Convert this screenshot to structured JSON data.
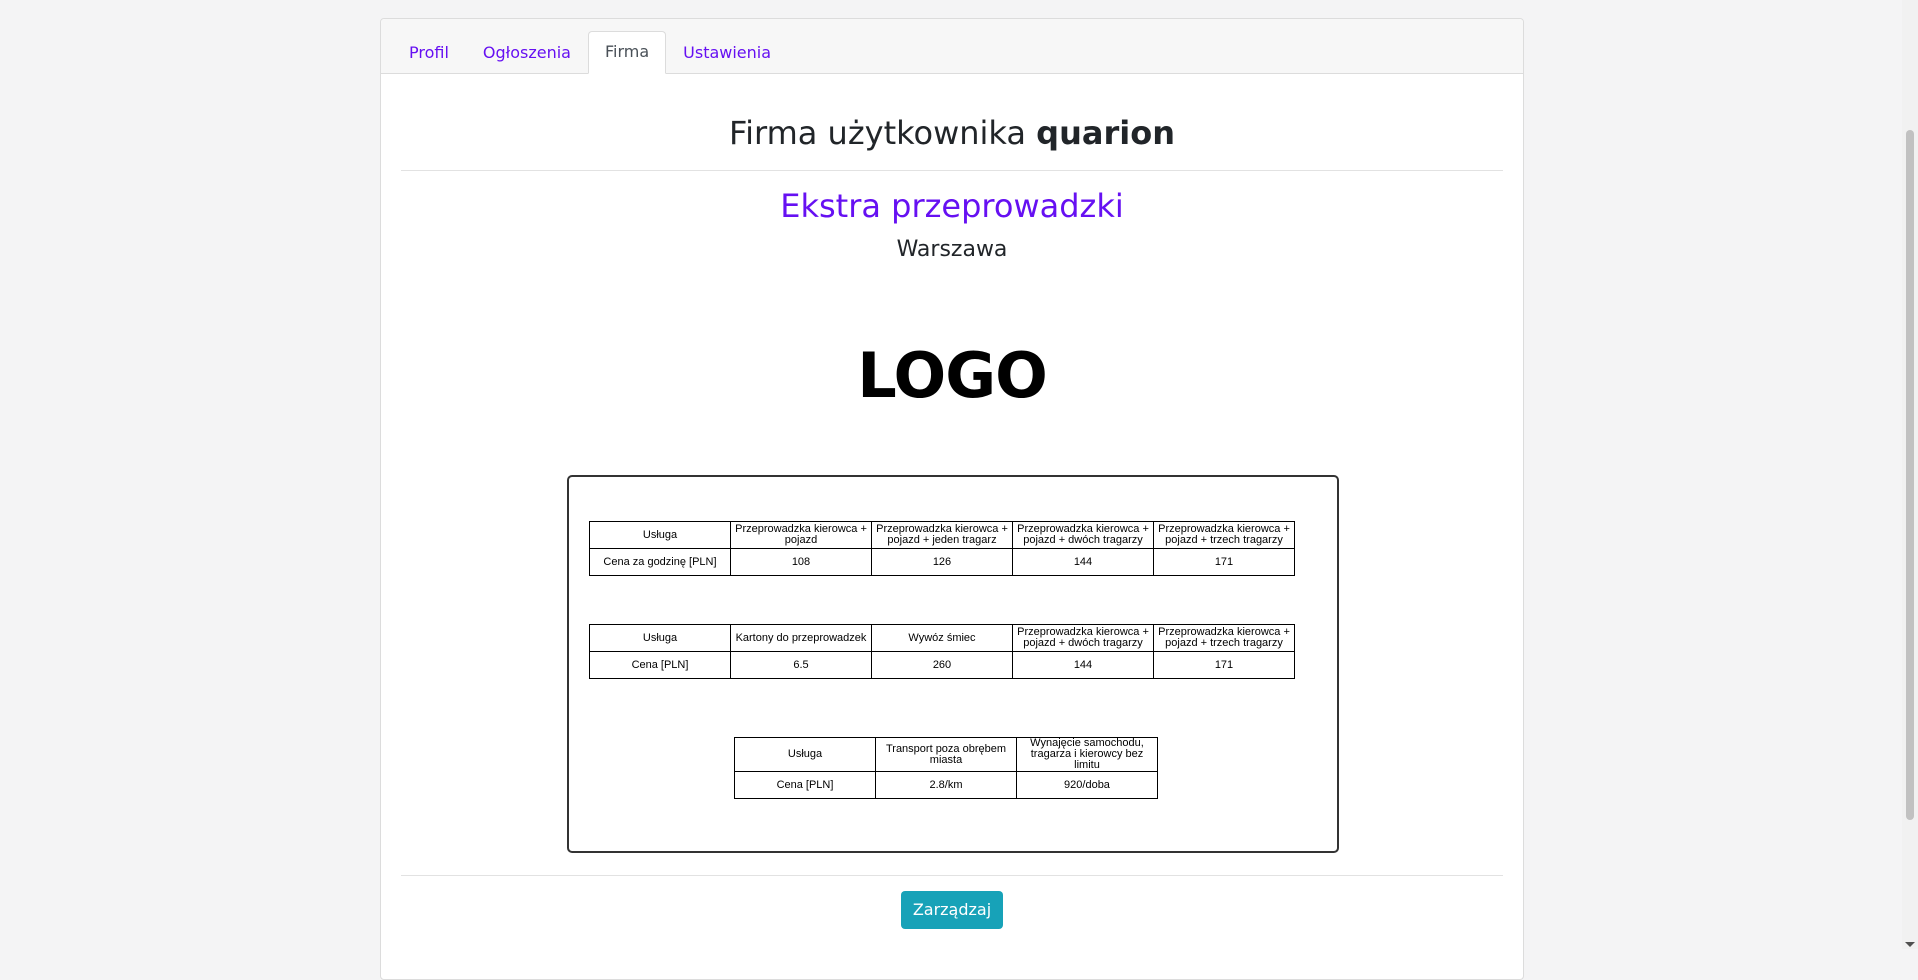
{
  "tabs": [
    {
      "label": "Profil"
    },
    {
      "label": "Ogłoszenia"
    },
    {
      "label": "Firma"
    },
    {
      "label": "Ustawienia"
    }
  ],
  "page": {
    "title_prefix": "Firma użytkownika",
    "username": "quarion",
    "company_name": "Ekstra przeprowadzki",
    "city": "Warszawa",
    "logo_text": "LOGO"
  },
  "price_tables": [
    {
      "header": [
        "Usługa",
        "Przeprowadzka kierowca + pojazd",
        "Przeprowadzka kierowca + pojazd + jeden tragarz",
        "Przeprowadzka kierowca + pojazd + dwóch tragarzy",
        "Przeprowadzka kierowca + pojazd + trzech tragarzy"
      ],
      "row": [
        "Cena za godzinę [PLN]",
        "108",
        "126",
        "144",
        "171"
      ]
    },
    {
      "header": [
        "Usługa",
        "Kartony do przeprowadzek",
        "Wywóz śmiec",
        "Przeprowadzka kierowca + pojazd + dwóch tragarzy",
        "Przeprowadzka kierowca + pojazd + trzech tragarzy"
      ],
      "row": [
        "Cena [PLN]",
        "6.5",
        "260",
        "144",
        "171"
      ]
    },
    {
      "header": [
        "Usługa",
        "Transport poza obrębem miasta",
        "Wynajęcie samochodu, tragarza i kierowcy bez limitu"
      ],
      "row": [
        "Cena [PLN]",
        "2.8/km",
        "920/doba"
      ]
    }
  ],
  "footer": {
    "manage_label": "Zarządzaj"
  },
  "colors": {
    "accent": "#6610f2",
    "button": "#17a2b8"
  }
}
